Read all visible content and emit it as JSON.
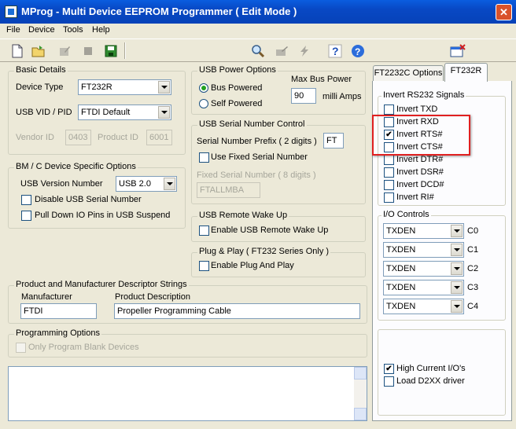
{
  "window": {
    "title": "MProg - Multi Device EEPROM Programmer ( Edit Mode )",
    "close": "✕"
  },
  "menu": [
    {
      "label": "File"
    },
    {
      "label": "Device"
    },
    {
      "label": "Tools"
    },
    {
      "label": "Help"
    }
  ],
  "basic_details": {
    "title": "Basic Details",
    "device_type_label": "Device Type",
    "device_type_value": "FT232R",
    "usb_vid_pid_label": "USB VID / PID",
    "usb_vid_pid_value": "FTDI Default",
    "vendor_id_label": "Vendor ID",
    "vendor_id_value": "0403",
    "product_id_label": "Product ID",
    "product_id_value": "6001"
  },
  "bm_c": {
    "title": "BM / C Device Specific Options",
    "usb_version_label": "USB Version Number",
    "usb_version_value": "USB 2.0",
    "disable_serial_label": "Disable USB Serial Number",
    "pull_down_label": "Pull Down IO Pins in USB Suspend"
  },
  "usb_power": {
    "title": "USB Power Options",
    "bus_powered_label": "Bus Powered",
    "self_powered_label": "Self Powered",
    "max_bus_power_label": "Max Bus Power",
    "max_bus_power_value": "90",
    "milli_amps_label": "milli Amps",
    "selected": "bus"
  },
  "serial_control": {
    "title": "USB Serial Number Control",
    "prefix_label": "Serial Number Prefix ( 2 digits )",
    "prefix_value": "FT",
    "use_fixed_label": "Use Fixed Serial Number",
    "fixed_label": "Fixed Serial Number ( 8 digits )",
    "fixed_value": "FTALLMBA"
  },
  "remote_wake": {
    "title": "USB Remote Wake Up",
    "enable_label": "Enable USB Remote Wake Up"
  },
  "plug_play": {
    "title": "Plug & Play  ( FT232 Series Only )",
    "enable_label": "Enable Plug And Play"
  },
  "descriptors": {
    "title": "Product and Manufacturer Descriptor Strings",
    "manufacturer_label": "Manufacturer",
    "manufacturer_value": "FTDI",
    "product_label": "Product Description",
    "product_value": "Propeller Programming Cable"
  },
  "programming": {
    "title": "Programming Options",
    "blank_label": "Only Program Blank Devices"
  },
  "tabs": [
    {
      "label": "FT2232C Options"
    },
    {
      "label": "FT232R"
    }
  ],
  "invert": {
    "title": "Invert RS232 Signals",
    "items": [
      {
        "label": "Invert TXD",
        "checked": false,
        "mark": ""
      },
      {
        "label": "Invert RXD",
        "checked": false,
        "mark": ""
      },
      {
        "label": "Invert RTS#",
        "checked": true,
        "mark": "✔"
      },
      {
        "label": "Invert CTS#",
        "checked": false,
        "mark": ""
      },
      {
        "label": "Invert DTR#",
        "checked": false,
        "mark": ""
      },
      {
        "label": "Invert DSR#",
        "checked": false,
        "mark": ""
      },
      {
        "label": "Invert DCD#",
        "checked": false,
        "mark": ""
      },
      {
        "label": "Invert RI#",
        "checked": false,
        "mark": ""
      }
    ]
  },
  "io_controls": {
    "title": "I/O Controls",
    "items": [
      {
        "value": "TXDEN",
        "label": "C0"
      },
      {
        "value": "TXDEN",
        "label": "C1"
      },
      {
        "value": "TXDEN",
        "label": "C2"
      },
      {
        "value": "TXDEN",
        "label": "C3"
      },
      {
        "value": "TXDEN",
        "label": "C4"
      }
    ]
  },
  "misc": {
    "items": [
      {
        "label": "High Current I/O's",
        "checked": true,
        "mark": "✔"
      },
      {
        "label": "Load D2XX driver",
        "checked": false,
        "mark": ""
      }
    ]
  }
}
